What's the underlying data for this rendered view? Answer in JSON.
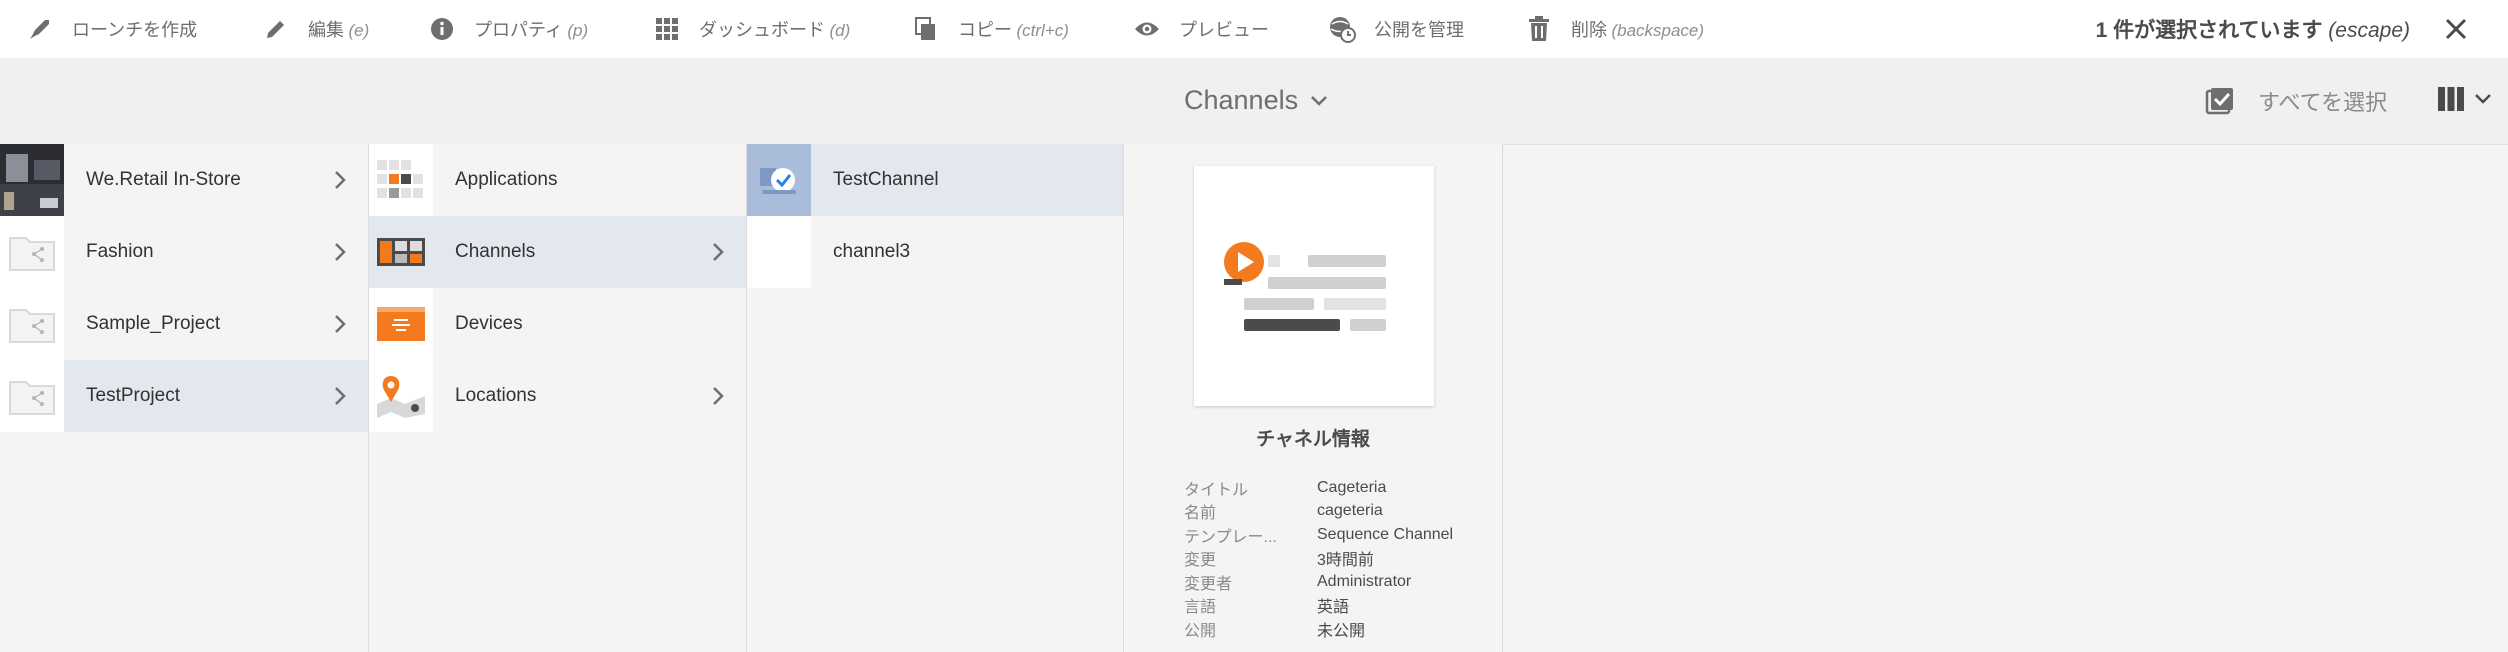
{
  "actions": [
    {
      "id": "create-launch",
      "label": "ローンチを作成",
      "hint": "",
      "icon": "rocket-icon"
    },
    {
      "id": "edit",
      "label": "編集",
      "hint": "(e)",
      "icon": "pencil-icon"
    },
    {
      "id": "properties",
      "label": "プロパティ",
      "hint": "(p)",
      "icon": "info-icon"
    },
    {
      "id": "dashboard",
      "label": "ダッシュボード",
      "hint": "(d)",
      "icon": "grid-icon"
    },
    {
      "id": "copy",
      "label": "コピー",
      "hint": "(ctrl+c)",
      "icon": "copy-icon"
    },
    {
      "id": "preview",
      "label": "プレビュー",
      "hint": "",
      "icon": "eye-icon"
    },
    {
      "id": "manage-publication",
      "label": "公開を管理",
      "hint": "",
      "icon": "globe-clock-icon"
    },
    {
      "id": "delete",
      "label": "削除",
      "hint": "(backspace)",
      "icon": "trash-icon"
    }
  ],
  "selection": {
    "text": "1 件が選択されています",
    "hint": "(escape)"
  },
  "title": "Channels",
  "select_all": "すべてを選択",
  "columns": {
    "col1": [
      {
        "name": "We.Retail In-Store",
        "thumb": "photo",
        "selected": false
      },
      {
        "name": "Fashion",
        "thumb": "folder",
        "selected": false
      },
      {
        "name": "Sample_Project",
        "thumb": "folder",
        "selected": false
      },
      {
        "name": "TestProject",
        "thumb": "folder",
        "selected": true
      }
    ],
    "col2": [
      {
        "name": "Applications",
        "thumb": "apps",
        "selected": false
      },
      {
        "name": "Channels",
        "thumb": "channels",
        "selected": true
      },
      {
        "name": "Devices",
        "thumb": "devices",
        "selected": false
      },
      {
        "name": "Locations",
        "thumb": "locations",
        "selected": false
      }
    ],
    "col3": [
      {
        "name": "TestChannel",
        "thumb": "check",
        "selected": true
      },
      {
        "name": "channel3",
        "thumb": "blank",
        "selected": false
      }
    ]
  },
  "preview": {
    "title": "チャネル情報",
    "meta": [
      {
        "k": "タイトル",
        "v": "Cageteria"
      },
      {
        "k": "名前",
        "v": "cageteria"
      },
      {
        "k": "テンプレー...",
        "v": "Sequence Channel"
      },
      {
        "k": "変更",
        "v": "3時間前"
      },
      {
        "k": "変更者",
        "v": "Administrator"
      },
      {
        "k": "言語",
        "v": "英語"
      },
      {
        "k": "公開",
        "v": "未公開"
      }
    ]
  },
  "colors": {
    "accent": "#f47a20",
    "selected_row": "#e3e7ee",
    "check_thumb": "#a9bdda"
  }
}
